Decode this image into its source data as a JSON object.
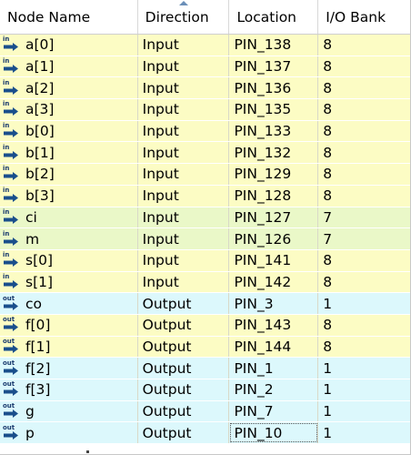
{
  "columns": [
    "Node Name",
    "Direction",
    "Location",
    "I/O Bank"
  ],
  "colors": {
    "bank8_row": "#fcfcc4",
    "bank7_row": "#eaf8c8",
    "bank1_row": "#dcf8fc",
    "pin_icon": "#1a4f8c"
  },
  "icons": {
    "input": "input-pin-icon",
    "output": "output-pin-icon"
  },
  "pins": [
    {
      "icon_tag": "in",
      "name": "a[0]",
      "direction": "Input",
      "location": "PIN_138",
      "bank": "8"
    },
    {
      "icon_tag": "in",
      "name": "a[1]",
      "direction": "Input",
      "location": "PIN_137",
      "bank": "8"
    },
    {
      "icon_tag": "in",
      "name": "a[2]",
      "direction": "Input",
      "location": "PIN_136",
      "bank": "8"
    },
    {
      "icon_tag": "in",
      "name": "a[3]",
      "direction": "Input",
      "location": "PIN_135",
      "bank": "8"
    },
    {
      "icon_tag": "in",
      "name": "b[0]",
      "direction": "Input",
      "location": "PIN_133",
      "bank": "8"
    },
    {
      "icon_tag": "in",
      "name": "b[1]",
      "direction": "Input",
      "location": "PIN_132",
      "bank": "8"
    },
    {
      "icon_tag": "in",
      "name": "b[2]",
      "direction": "Input",
      "location": "PIN_129",
      "bank": "8"
    },
    {
      "icon_tag": "in",
      "name": "b[3]",
      "direction": "Input",
      "location": "PIN_128",
      "bank": "8"
    },
    {
      "icon_tag": "in",
      "name": "ci",
      "direction": "Input",
      "location": "PIN_127",
      "bank": "7"
    },
    {
      "icon_tag": "in",
      "name": "m",
      "direction": "Input",
      "location": "PIN_126",
      "bank": "7"
    },
    {
      "icon_tag": "in",
      "name": "s[0]",
      "direction": "Input",
      "location": "PIN_141",
      "bank": "8"
    },
    {
      "icon_tag": "in",
      "name": "s[1]",
      "direction": "Input",
      "location": "PIN_142",
      "bank": "8"
    },
    {
      "icon_tag": "out",
      "name": "co",
      "direction": "Output",
      "location": "PIN_3",
      "bank": "1"
    },
    {
      "icon_tag": "out",
      "name": "f[0]",
      "direction": "Output",
      "location": "PIN_143",
      "bank": "8"
    },
    {
      "icon_tag": "out",
      "name": "f[1]",
      "direction": "Output",
      "location": "PIN_144",
      "bank": "8"
    },
    {
      "icon_tag": "out",
      "name": "f[2]",
      "direction": "Output",
      "location": "PIN_1",
      "bank": "1"
    },
    {
      "icon_tag": "out",
      "name": "f[3]",
      "direction": "Output",
      "location": "PIN_2",
      "bank": "1"
    },
    {
      "icon_tag": "out",
      "name": "g",
      "direction": "Output",
      "location": "PIN_7",
      "bank": "1"
    },
    {
      "icon_tag": "out",
      "name": "p",
      "direction": "Output",
      "location": "PIN_10",
      "bank": "1",
      "selected": true
    }
  ]
}
